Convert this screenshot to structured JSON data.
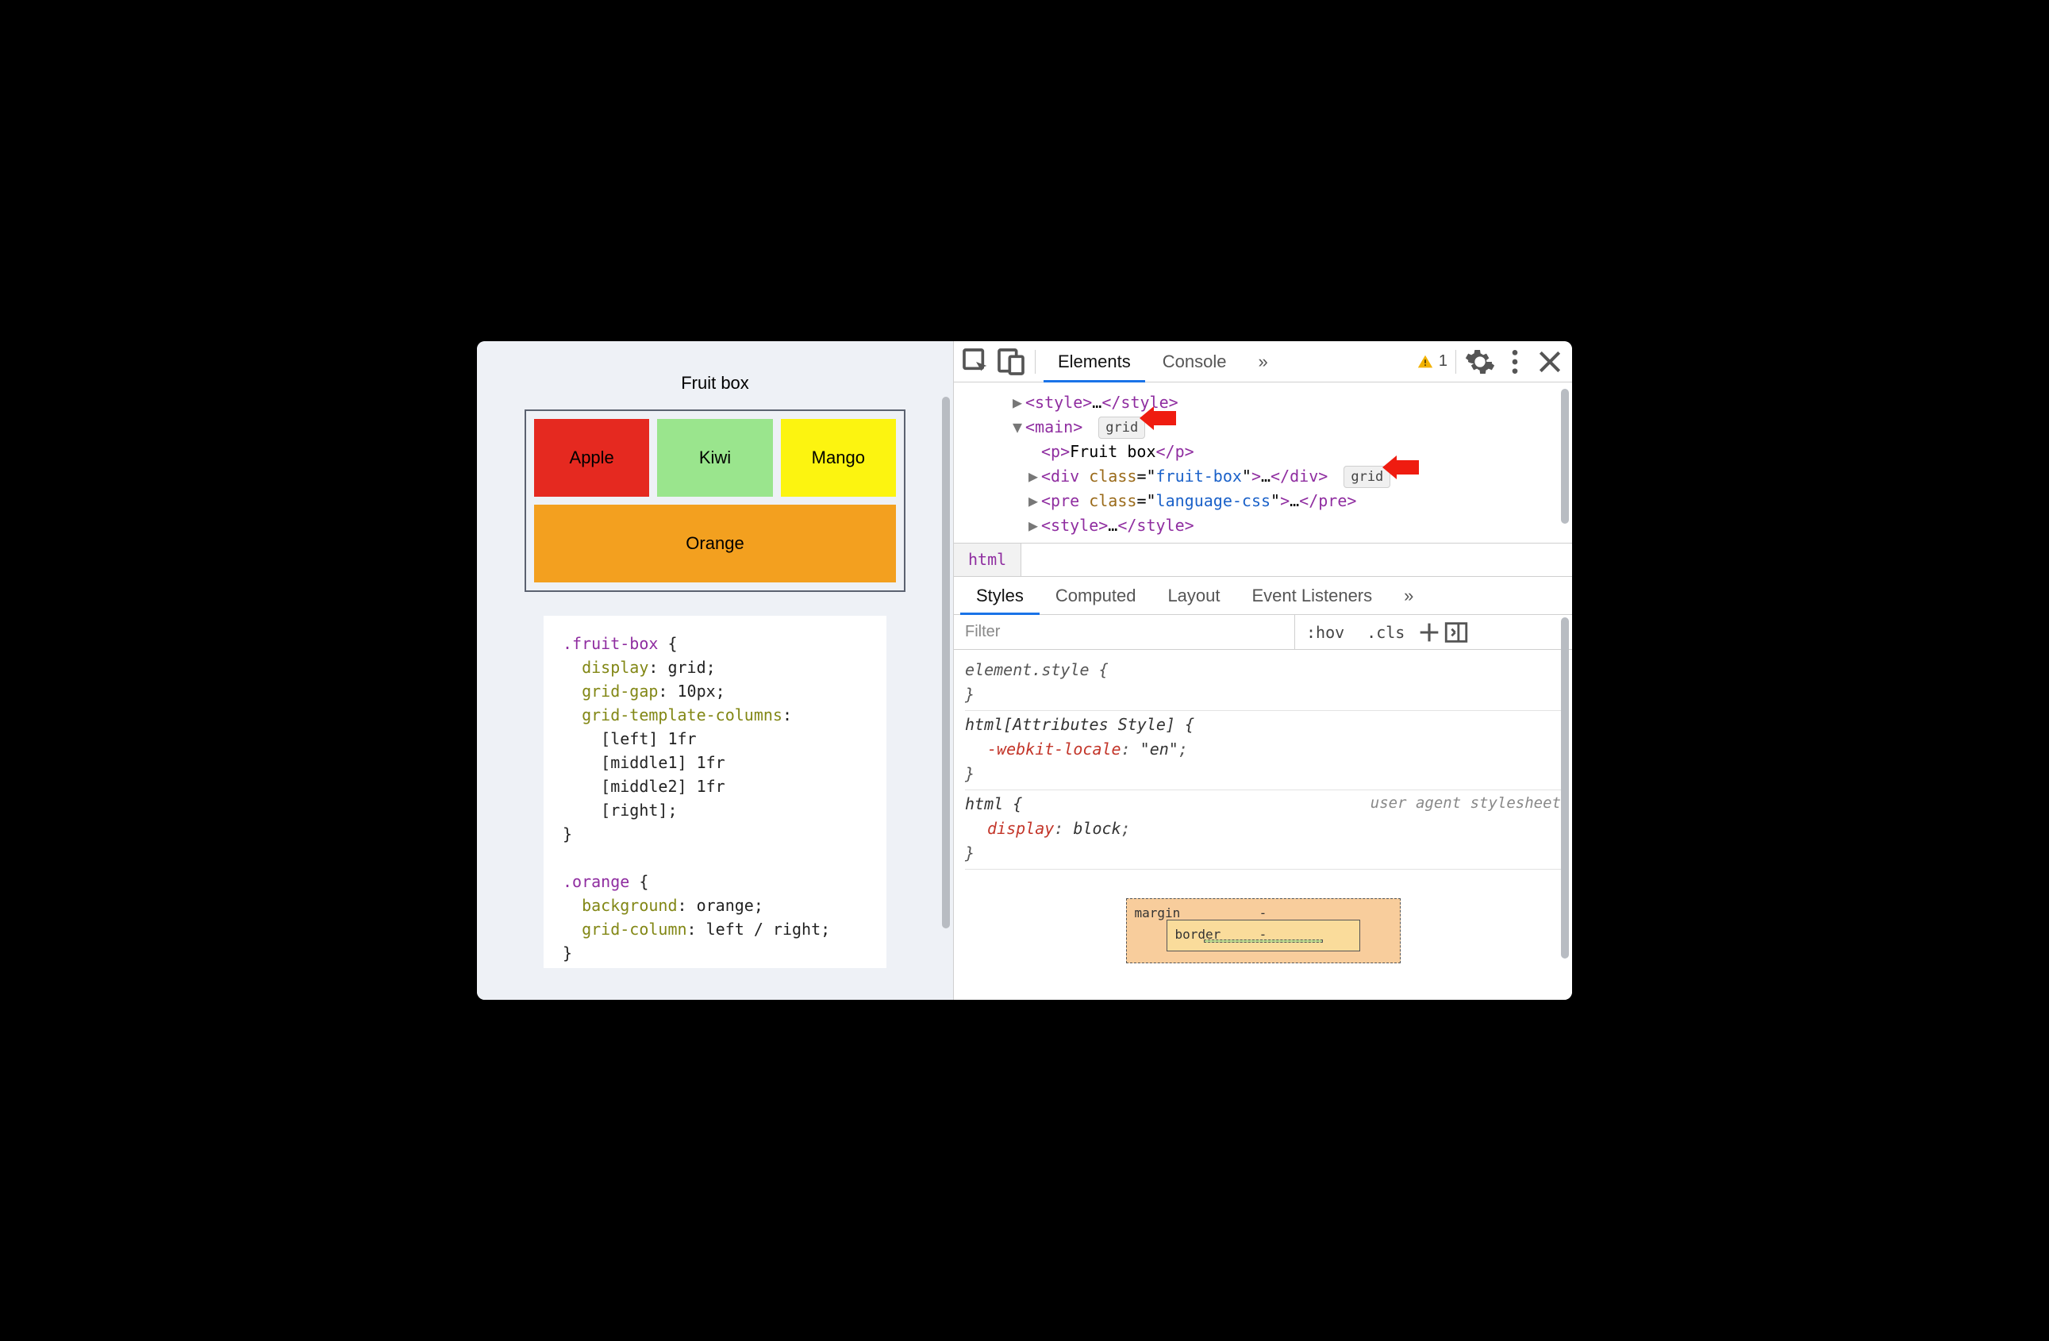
{
  "page": {
    "title": "Fruit box",
    "fruits": {
      "apple": "Apple",
      "kiwi": "Kiwi",
      "mango": "Mango",
      "orange": "Orange"
    },
    "code_lines": [
      {
        "t": "sel",
        "v": ".fruit-box "
      },
      {
        "t": "txt",
        "v": "{\n"
      },
      {
        "t": "txt",
        "v": "  "
      },
      {
        "t": "prop",
        "v": "display"
      },
      {
        "t": "txt",
        "v": ": grid;\n"
      },
      {
        "t": "txt",
        "v": "  "
      },
      {
        "t": "prop",
        "v": "grid-gap"
      },
      {
        "t": "txt",
        "v": ": 10px;\n"
      },
      {
        "t": "txt",
        "v": "  "
      },
      {
        "t": "prop",
        "v": "grid-template-columns"
      },
      {
        "t": "txt",
        "v": ":\n"
      },
      {
        "t": "txt",
        "v": "    [left] 1fr\n"
      },
      {
        "t": "txt",
        "v": "    [middle1] 1fr\n"
      },
      {
        "t": "txt",
        "v": "    [middle2] 1fr\n"
      },
      {
        "t": "txt",
        "v": "    [right];\n"
      },
      {
        "t": "txt",
        "v": "}\n\n"
      },
      {
        "t": "sel",
        "v": ".orange "
      },
      {
        "t": "txt",
        "v": "{\n"
      },
      {
        "t": "txt",
        "v": "  "
      },
      {
        "t": "prop",
        "v": "background"
      },
      {
        "t": "txt",
        "v": ": orange;\n"
      },
      {
        "t": "txt",
        "v": "  "
      },
      {
        "t": "prop",
        "v": "grid-column"
      },
      {
        "t": "txt",
        "v": ": left / right;\n"
      },
      {
        "t": "txt",
        "v": "}"
      }
    ]
  },
  "devtools": {
    "tabs": {
      "elements": "Elements",
      "console": "Console",
      "more": "»"
    },
    "warn_count": "1",
    "dom": {
      "l0": "<style>…</style>",
      "l1_open": "<main>",
      "grid_pill": "grid",
      "l2": "<p>Fruit box</p>",
      "l3": "<div class=\"fruit-box\">…</div>",
      "l4": "<pre class=\"language-css\">…</pre>",
      "l5": "<style>…</style>"
    },
    "crumb": "html",
    "subtabs": {
      "styles": "Styles",
      "computed": "Computed",
      "layout": "Layout",
      "events": "Event Listeners",
      "more": "»"
    },
    "filter_placeholder": "Filter",
    "filter_btns": {
      "hov": ":hov",
      "cls": ".cls"
    },
    "rules": {
      "element_style": "element.style {",
      "close": "}",
      "attr_sel": "html[Attributes Style] {",
      "locale_prop": "-webkit-locale",
      "locale_val": "\"en\"",
      "html_sel": "html {",
      "display_prop": "display",
      "display_val": "block",
      "ua_note": "user agent stylesheet"
    },
    "boxmodel": {
      "margin": "margin",
      "border": "border",
      "dash": "-"
    }
  }
}
